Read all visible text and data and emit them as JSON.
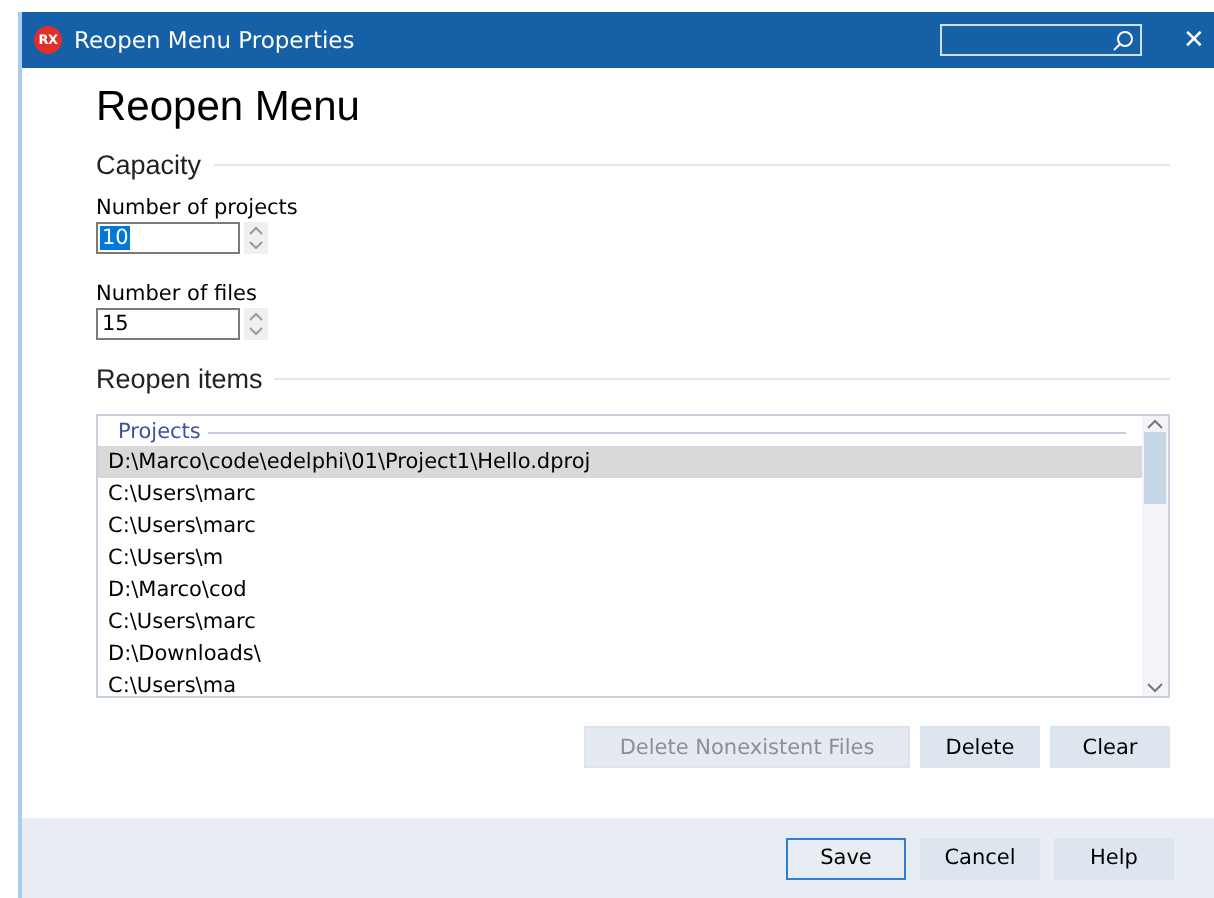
{
  "window": {
    "app_logo": "RX",
    "title": "Reopen Menu Properties",
    "close": "✕"
  },
  "heading": "Reopen Menu",
  "capacity": {
    "title": "Capacity",
    "fields": [
      {
        "label": "Number of projects",
        "value": "10",
        "value_selected": true
      },
      {
        "label": "Number of files",
        "value": "15",
        "value_selected": false
      }
    ]
  },
  "reopen_items": {
    "title": "Reopen items",
    "list_header": "Projects",
    "rows": [
      {
        "text": "D:\\Marco\\code\\edelphi\\01\\Project1\\Hello.dproj",
        "selected": true
      },
      {
        "text": "C:\\Users\\marc",
        "selected": false
      },
      {
        "text": "C:\\Users\\marc",
        "selected": false
      },
      {
        "text": "C:\\Users\\m",
        "selected": false
      },
      {
        "text": "D:\\Marco\\cod",
        "selected": false
      },
      {
        "text": "C:\\Users\\marc",
        "selected": false
      },
      {
        "text": "D:\\Downloads\\",
        "selected": false
      },
      {
        "text": "C:\\Users\\ma",
        "selected": false
      }
    ],
    "buttons": [
      {
        "label": "Delete Nonexistent Files",
        "disabled": true
      },
      {
        "label": "Delete",
        "disabled": false
      },
      {
        "label": "Clear",
        "disabled": false
      }
    ]
  },
  "footer_buttons": [
    {
      "label": "Save",
      "default": true
    },
    {
      "label": "Cancel",
      "default": false
    },
    {
      "label": "Help",
      "default": false
    }
  ]
}
